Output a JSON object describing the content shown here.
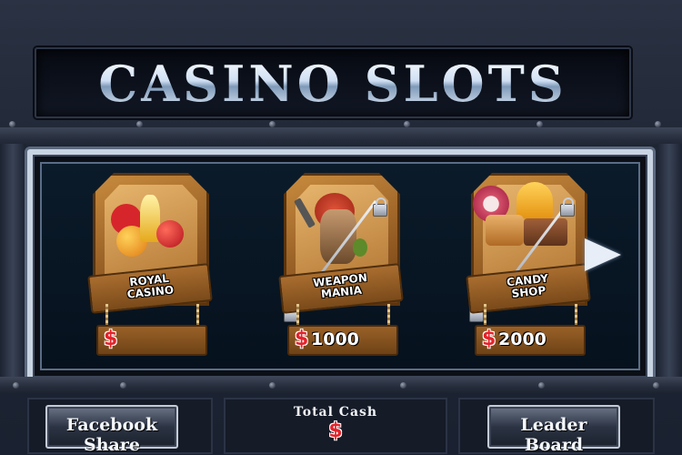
{
  "header": {
    "title": "CASINO SLOTS"
  },
  "games": [
    {
      "line1": "ROYAL",
      "line2": "CASINO",
      "currency": "$",
      "price": "",
      "locked": false
    },
    {
      "line1": "WEAPON",
      "line2": "MANIA",
      "currency": "$",
      "price": "1000",
      "locked": true
    },
    {
      "line1": "CANDY",
      "line2": "SHOP",
      "currency": "$",
      "price": "2000",
      "locked": true
    }
  ],
  "footer": {
    "facebook_label": "Facebook Share",
    "cash_label": "Total Cash",
    "cash_symbol": "$",
    "leaderboard_label": "Leader Board"
  },
  "colors": {
    "accent_red": "#e4232b",
    "wood": "#8c5520",
    "frame_silver": "#c9d4e3"
  },
  "icons": [
    "next-arrow-icon",
    "lock-icon",
    "dollar-icon"
  ]
}
